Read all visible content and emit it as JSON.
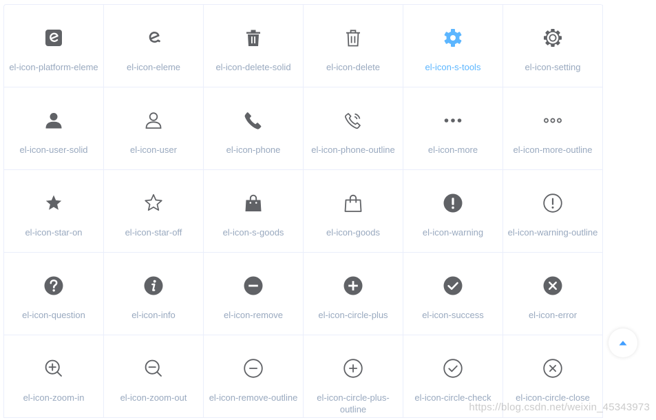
{
  "colors": {
    "icon": "#606266",
    "label": "#99a9bf",
    "active": "#5cb6ff",
    "border": "#eaeefb",
    "backtop_arrow": "#409eff"
  },
  "icons": [
    {
      "name": "el-icon-platform-eleme",
      "icon": "platform-eleme-icon",
      "active": false
    },
    {
      "name": "el-icon-eleme",
      "icon": "eleme-icon",
      "active": false
    },
    {
      "name": "el-icon-delete-solid",
      "icon": "delete-solid-icon",
      "active": false
    },
    {
      "name": "el-icon-delete",
      "icon": "delete-icon",
      "active": false
    },
    {
      "name": "el-icon-s-tools",
      "icon": "s-tools-icon",
      "active": true
    },
    {
      "name": "el-icon-setting",
      "icon": "setting-icon",
      "active": false
    },
    {
      "name": "el-icon-user-solid",
      "icon": "user-solid-icon",
      "active": false
    },
    {
      "name": "el-icon-user",
      "icon": "user-icon",
      "active": false
    },
    {
      "name": "el-icon-phone",
      "icon": "phone-icon",
      "active": false
    },
    {
      "name": "el-icon-phone-outline",
      "icon": "phone-outline-icon",
      "active": false
    },
    {
      "name": "el-icon-more",
      "icon": "more-icon",
      "active": false
    },
    {
      "name": "el-icon-more-outline",
      "icon": "more-outline-icon",
      "active": false
    },
    {
      "name": "el-icon-star-on",
      "icon": "star-on-icon",
      "active": false
    },
    {
      "name": "el-icon-star-off",
      "icon": "star-off-icon",
      "active": false
    },
    {
      "name": "el-icon-s-goods",
      "icon": "s-goods-icon",
      "active": false
    },
    {
      "name": "el-icon-goods",
      "icon": "goods-icon",
      "active": false
    },
    {
      "name": "el-icon-warning",
      "icon": "warning-icon",
      "active": false
    },
    {
      "name": "el-icon-warning-outline",
      "icon": "warning-outline-icon",
      "active": false
    },
    {
      "name": "el-icon-question",
      "icon": "question-icon",
      "active": false
    },
    {
      "name": "el-icon-info",
      "icon": "info-icon",
      "active": false
    },
    {
      "name": "el-icon-remove",
      "icon": "remove-icon",
      "active": false
    },
    {
      "name": "el-icon-circle-plus",
      "icon": "circle-plus-icon",
      "active": false
    },
    {
      "name": "el-icon-success",
      "icon": "success-icon",
      "active": false
    },
    {
      "name": "el-icon-error",
      "icon": "error-icon",
      "active": false
    },
    {
      "name": "el-icon-zoom-in",
      "icon": "zoom-in-icon",
      "active": false
    },
    {
      "name": "el-icon-zoom-out",
      "icon": "zoom-out-icon",
      "active": false
    },
    {
      "name": "el-icon-remove-outline",
      "icon": "remove-outline-icon",
      "active": false
    },
    {
      "name": "el-icon-circle-plus-outline",
      "icon": "circle-plus-outline-icon",
      "active": false
    },
    {
      "name": "el-icon-circle-check",
      "icon": "circle-check-icon",
      "active": false
    },
    {
      "name": "el-icon-circle-close",
      "icon": "circle-close-icon",
      "active": false
    }
  ],
  "backtop": {
    "icon": "caret-top-icon"
  },
  "watermark": "https://blog.csdn.net/weixin_45343973"
}
